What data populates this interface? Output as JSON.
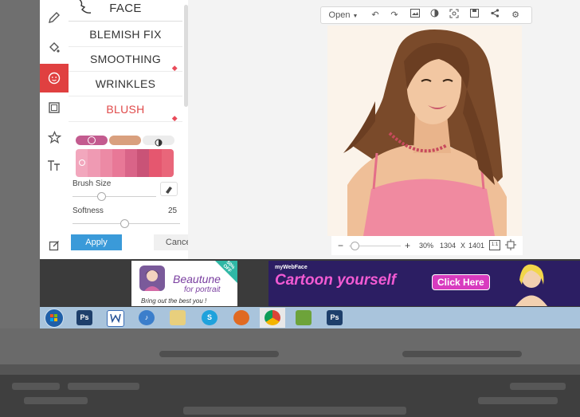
{
  "menu": {
    "items": [
      {
        "label": "FACE",
        "premium": false
      },
      {
        "label": "BLEMISH FIX",
        "premium": false
      },
      {
        "label": "SMOOTHING",
        "premium": true
      },
      {
        "label": "WRINKLES",
        "premium": false
      },
      {
        "label": "BLUSH",
        "premium": true
      }
    ]
  },
  "controls": {
    "brush_size_label": "Brush Size",
    "softness_label": "Softness",
    "softness_value": "25",
    "apply_label": "Apply",
    "cancel_label": "Cancel",
    "palette": [
      "#e88aa6",
      "#e97a97",
      "#e7698a",
      "#d9557a",
      "#c9476c",
      "#e24c67"
    ]
  },
  "toolbar": {
    "open_label": "Open"
  },
  "zoom": {
    "minus": "−",
    "plus": "+",
    "percent": "30%",
    "width": "1304",
    "x": "X",
    "height": "1401",
    "fit_label": "1:1"
  },
  "ads": {
    "beautune": {
      "title": "Beautune",
      "subtitle": "for portrait",
      "tagline": "Bring out the best you !",
      "badge": "50% OFF"
    },
    "mywebface": {
      "brand": "myWebFace",
      "headline": "Cartoon yourself",
      "button": "Click Here"
    }
  },
  "taskbar": {
    "ps1": "Ps",
    "ps2": "Ps"
  },
  "colors": {
    "accent_red": "#e04040",
    "apply_blue": "#3a9ad9",
    "blush_text": "#e04a4a"
  }
}
